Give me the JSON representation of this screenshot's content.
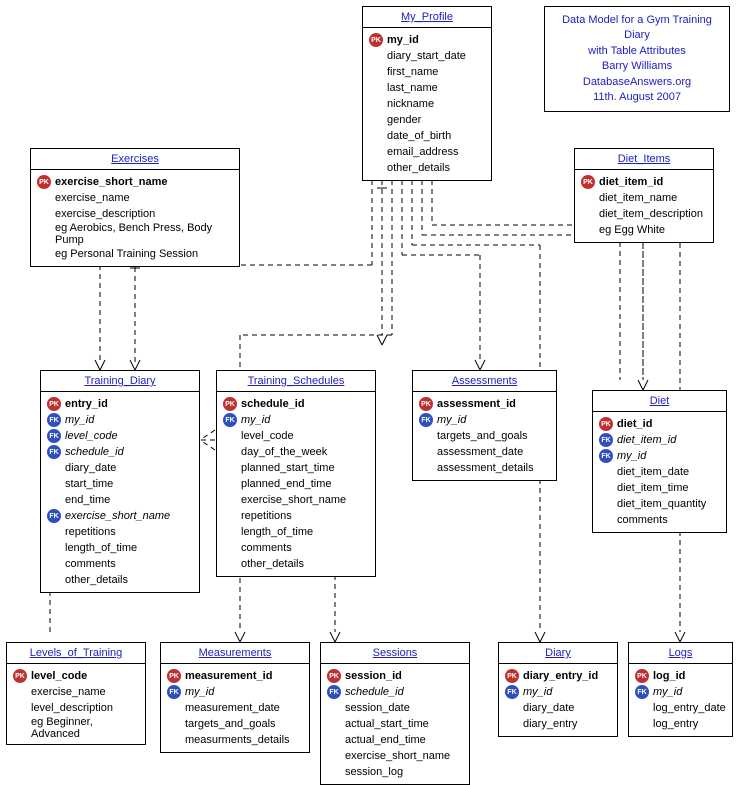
{
  "info": {
    "l1": "Data Model for a Gym Training Diary",
    "l2": "with Table Attributes",
    "l3": "Barry Williams",
    "l4": "DatabaseAnswers.org",
    "l5": "11th. August 2007"
  },
  "my_profile": {
    "title": "My_Profile",
    "fields": [
      {
        "k": "pk",
        "t": "my_id",
        "b": 1
      },
      {
        "t": "diary_start_date"
      },
      {
        "t": "first_name"
      },
      {
        "t": "last_name"
      },
      {
        "t": "nickname"
      },
      {
        "t": "gender"
      },
      {
        "t": "date_of_birth"
      },
      {
        "t": "email_address"
      },
      {
        "t": "other_details"
      }
    ]
  },
  "exercises": {
    "title": "Exercises",
    "fields": [
      {
        "k": "pk",
        "t": "exercise_short_name",
        "b": 1
      },
      {
        "t": "exercise_name"
      },
      {
        "t": "exercise_description"
      },
      {
        "t": "eg Aerobics, Bench Press, Body Pump"
      },
      {
        "t": "eg Personal Training Session"
      }
    ]
  },
  "diet_items": {
    "title": "Diet_Items",
    "fields": [
      {
        "k": "pk",
        "t": "diet_item_id",
        "b": 1
      },
      {
        "t": "diet_item_name"
      },
      {
        "t": "diet_item_description"
      },
      {
        "t": "eg Egg White"
      }
    ]
  },
  "training_diary": {
    "title": "Training_Diary",
    "fields": [
      {
        "k": "pk",
        "t": "entry_id",
        "b": 1
      },
      {
        "k": "fk",
        "t": "my_id",
        "i": 1
      },
      {
        "k": "fk",
        "t": "level_code",
        "i": 1
      },
      {
        "k": "fk",
        "t": "schedule_id",
        "i": 1
      },
      {
        "t": "diary_date"
      },
      {
        "t": "start_time"
      },
      {
        "t": "end_time"
      },
      {
        "k": "fk",
        "t": "exercise_short_name",
        "i": 1
      },
      {
        "t": "repetitions"
      },
      {
        "t": "length_of_time"
      },
      {
        "t": "comments"
      },
      {
        "t": "other_details"
      }
    ]
  },
  "training_schedules": {
    "title": "Training_Schedules",
    "fields": [
      {
        "k": "pk",
        "t": "schedule_id",
        "b": 1
      },
      {
        "k": "fk",
        "t": "my_id",
        "i": 1
      },
      {
        "t": "level_code"
      },
      {
        "t": "day_of_the_week"
      },
      {
        "t": "planned_start_time"
      },
      {
        "t": "planned_end_time"
      },
      {
        "t": "exercise_short_name"
      },
      {
        "t": "repetitions"
      },
      {
        "t": "length_of_time"
      },
      {
        "t": "comments"
      },
      {
        "t": "other_details"
      }
    ]
  },
  "assessments": {
    "title": "Assessments",
    "fields": [
      {
        "k": "pk",
        "t": "assessment_id",
        "b": 1
      },
      {
        "k": "fk",
        "t": "my_id",
        "i": 1
      },
      {
        "t": "targets_and_goals"
      },
      {
        "t": "assessment_date"
      },
      {
        "t": "assessment_details"
      }
    ]
  },
  "diet": {
    "title": "Diet",
    "fields": [
      {
        "k": "pk",
        "t": "diet_id",
        "b": 1
      },
      {
        "k": "fk",
        "t": "diet_item_id",
        "i": 1
      },
      {
        "k": "fk",
        "t": "my_id",
        "i": 1
      },
      {
        "t": "diet_item_date"
      },
      {
        "t": "diet_item_time"
      },
      {
        "t": "diet_item_quantity"
      },
      {
        "t": "comments"
      }
    ]
  },
  "levels": {
    "title": "Levels_of_Training",
    "fields": [
      {
        "k": "pk",
        "t": "level_code",
        "b": 1
      },
      {
        "t": "exercise_name"
      },
      {
        "t": "level_description"
      },
      {
        "t": "eg Beginner, Advanced"
      }
    ]
  },
  "measurements": {
    "title": "Measurements",
    "fields": [
      {
        "k": "pk",
        "t": "measurement_id",
        "b": 1
      },
      {
        "k": "fk",
        "t": "my_id",
        "i": 1
      },
      {
        "t": "measurement_date"
      },
      {
        "t": "targets_and_goals"
      },
      {
        "t": "measurments_details"
      }
    ]
  },
  "sessions": {
    "title": "Sessions",
    "fields": [
      {
        "k": "pk",
        "t": "session_id",
        "b": 1
      },
      {
        "k": "fk",
        "t": "schedule_id",
        "i": 1
      },
      {
        "t": "session_date"
      },
      {
        "t": "actual_start_time"
      },
      {
        "t": "actual_end_time"
      },
      {
        "t": "exercise_short_name"
      },
      {
        "t": "session_log"
      }
    ]
  },
  "diary": {
    "title": "Diary",
    "fields": [
      {
        "k": "pk",
        "t": "diary_entry_id",
        "b": 1
      },
      {
        "k": "fk",
        "t": "my_id",
        "i": 1
      },
      {
        "t": "diary_date"
      },
      {
        "t": "diary_entry"
      }
    ]
  },
  "logs": {
    "title": "Logs",
    "fields": [
      {
        "k": "pk",
        "t": "log_id",
        "b": 1
      },
      {
        "k": "fk",
        "t": "my_id",
        "i": 1
      },
      {
        "t": "log_entry_date"
      },
      {
        "t": "log_entry"
      }
    ]
  }
}
